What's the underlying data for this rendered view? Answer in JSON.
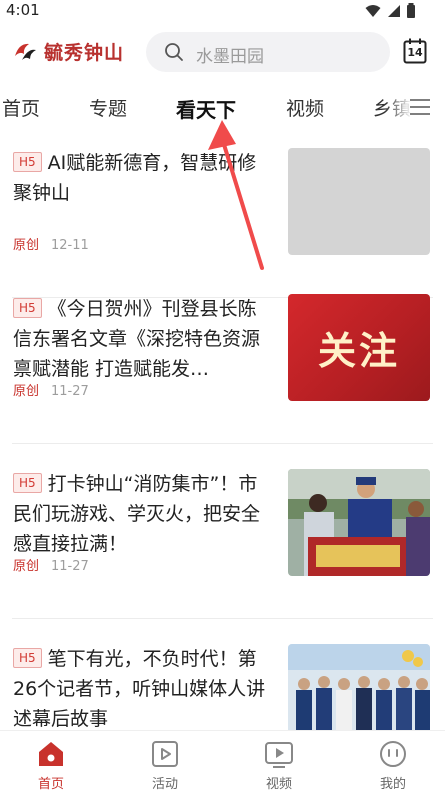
{
  "status_bar": {
    "time": "4:01"
  },
  "header": {
    "logo_text": "毓秀钟山",
    "search_placeholder": "水墨田园",
    "calendar_day": "14"
  },
  "tabs": [
    {
      "label": "首页"
    },
    {
      "label": "专题"
    },
    {
      "label": "看天下",
      "active": true
    },
    {
      "label": "视频"
    },
    {
      "label": "乡镇"
    }
  ],
  "news": [
    {
      "tag": "H5",
      "title": "AI赋能新德育，智慧研修聚钟山",
      "source": "原创",
      "date": "12-11",
      "thumb": "gray-placeholder"
    },
    {
      "tag": "H5",
      "title": "《今日贺州》刊登县长陈信东署名文章《深挖特色资源禀赋潜能 打造赋能发…",
      "source": "原创",
      "date": "11-27",
      "thumb": "red-banner",
      "thumb_text": "关注"
    },
    {
      "tag": "H5",
      "title": "打卡钟山“消防集市”！市民们玩游戏、学灭火，把安全感直接拉满！",
      "source": "原创",
      "date": "11-27",
      "thumb": "photo-firefighters"
    },
    {
      "tag": "H5",
      "title": "笔下有光，不负时代！第26个记者节，听钟山媒体人讲述幕后故事",
      "source": "",
      "date": "",
      "thumb": "photo-group"
    }
  ],
  "bottom_nav": [
    {
      "label": "首页",
      "icon": "home-icon",
      "active": true
    },
    {
      "label": "活动",
      "icon": "activity-icon"
    },
    {
      "label": "视频",
      "icon": "video-icon"
    },
    {
      "label": "我的",
      "icon": "profile-icon"
    }
  ],
  "colors": {
    "brand": "#c8322c",
    "arrow": "#f04b4b"
  }
}
